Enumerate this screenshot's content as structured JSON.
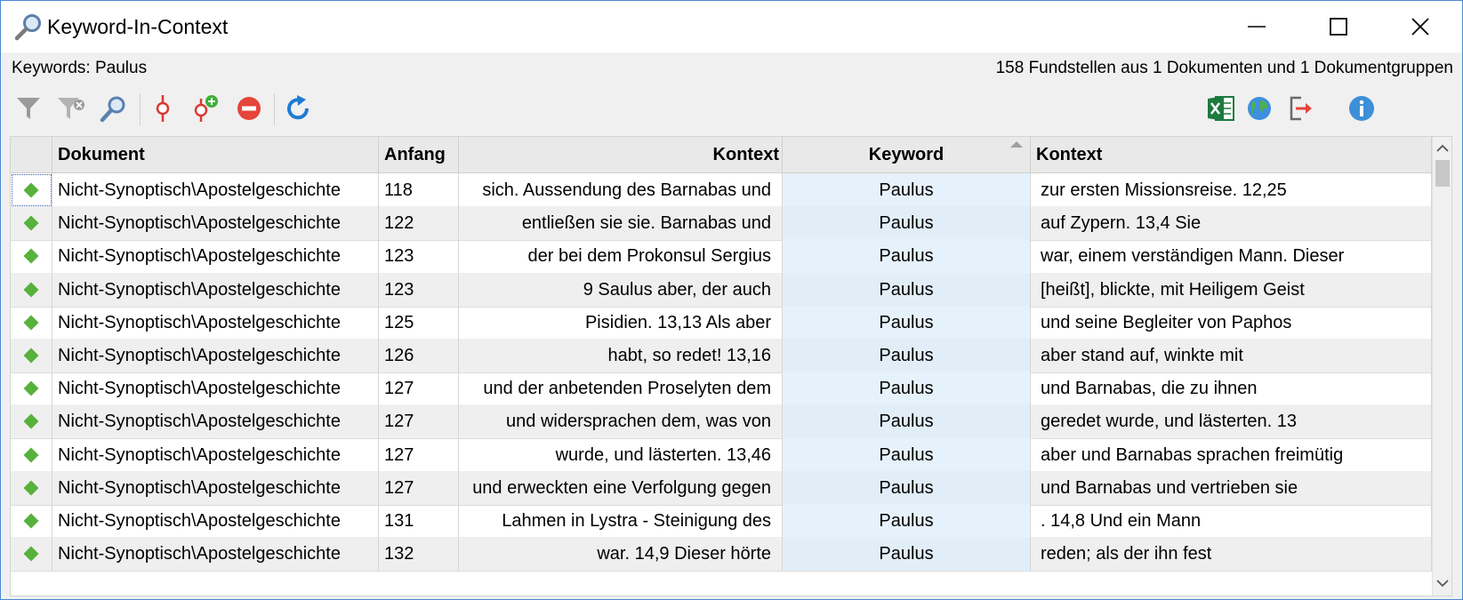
{
  "window": {
    "title": "Keyword-In-Context",
    "controls": {
      "minimize": "minimize",
      "maximize": "maximize",
      "close": "close"
    }
  },
  "info": {
    "keywords_label": "Keywords: Paulus",
    "stats": "158 Fundstellen aus 1 Dokumenten und 1 Dokumentgruppen"
  },
  "toolbar": {
    "left": [
      "filter-icon",
      "filter-clear-icon",
      "search-icon",
      "pin-icon",
      "pin-add-icon",
      "remove-icon",
      "refresh-icon"
    ],
    "right": [
      "excel-export-icon",
      "globe-icon",
      "export-exit-icon",
      "info-icon"
    ]
  },
  "colors": {
    "accent": "#1e7bd2",
    "marker": "#56b13d",
    "remove": "#e5453a",
    "excel": "#1d7a3e",
    "keyword_bg": "#e6f2fb"
  },
  "table": {
    "columns": [
      "",
      "Dokument",
      "Anfang",
      "Kontext",
      "Keyword",
      "Kontext"
    ],
    "rows": [
      {
        "dokument": "Nicht-Synoptisch\\Apostelgeschichte",
        "anfang": "118",
        "left": "sich.   Aussendung des Barnabas und",
        "keyword": "Paulus",
        "right": "zur ersten Missionsreise.  12,25"
      },
      {
        "dokument": "Nicht-Synoptisch\\Apostelgeschichte",
        "anfang": "122",
        "left": "entließen sie sie.   Barnabas und",
        "keyword": "Paulus",
        "right": "auf Zypern.  13,4 Sie"
      },
      {
        "dokument": "Nicht-Synoptisch\\Apostelgeschichte",
        "anfang": "123",
        "left": "der bei dem Prokonsul Sergius",
        "keyword": "Paulus",
        "right": "war, einem verständigen Mann. Dieser"
      },
      {
        "dokument": "Nicht-Synoptisch\\Apostelgeschichte",
        "anfang": "123",
        "left": "9 Saulus aber, der auch",
        "keyword": "Paulus",
        "right": "[heißt], blickte, mit Heiligem Geist"
      },
      {
        "dokument": "Nicht-Synoptisch\\Apostelgeschichte",
        "anfang": "125",
        "left": "Pisidien.  13,13 Als aber",
        "keyword": "Paulus",
        "right": "und seine Begleiter von Paphos"
      },
      {
        "dokument": "Nicht-Synoptisch\\Apostelgeschichte",
        "anfang": "126",
        "left": "habt, so redet! 13,16",
        "keyword": "Paulus",
        "right": "aber stand auf, winkte mit"
      },
      {
        "dokument": "Nicht-Synoptisch\\Apostelgeschichte",
        "anfang": "127",
        "left": "und der anbetenden Proselyten dem",
        "keyword": "Paulus",
        "right": "und Barnabas, die zu ihnen"
      },
      {
        "dokument": "Nicht-Synoptisch\\Apostelgeschichte",
        "anfang": "127",
        "left": "und widersprachen dem, was von",
        "keyword": "Paulus",
        "right": "geredet wurde, und lästerten. 13"
      },
      {
        "dokument": "Nicht-Synoptisch\\Apostelgeschichte",
        "anfang": "127",
        "left": "wurde, und lästerten. 13,46",
        "keyword": "Paulus",
        "right": "aber und Barnabas sprachen freimütig"
      },
      {
        "dokument": "Nicht-Synoptisch\\Apostelgeschichte",
        "anfang": "127",
        "left": "und erweckten eine Verfolgung gegen",
        "keyword": "Paulus",
        "right": "und Barnabas und vertrieben sie"
      },
      {
        "dokument": "Nicht-Synoptisch\\Apostelgeschichte",
        "anfang": "131",
        "left": "Lahmen in Lystra - Steinigung des",
        "keyword": "Paulus",
        "right": ".  14,8 Und ein Mann"
      },
      {
        "dokument": "Nicht-Synoptisch\\Apostelgeschichte",
        "anfang": "132",
        "left": "war. 14,9 Dieser hörte",
        "keyword": "Paulus",
        "right": "reden; als der ihn fest"
      }
    ]
  }
}
